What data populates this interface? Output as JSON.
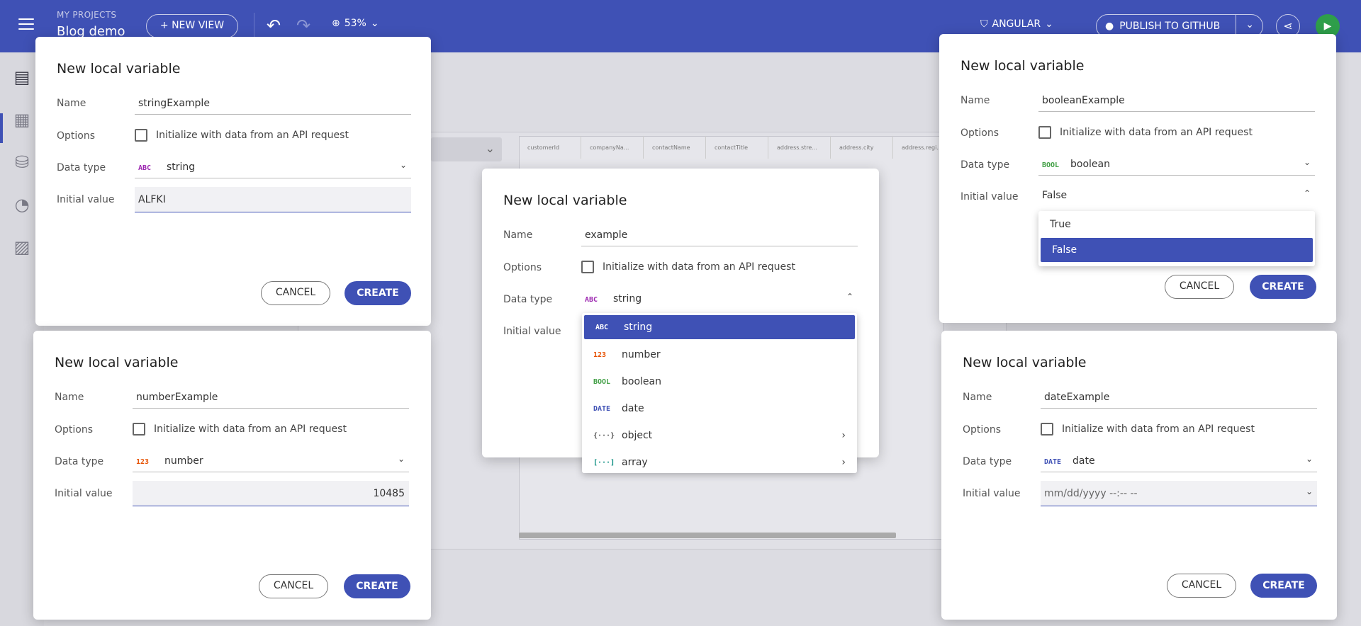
{
  "topbar": {
    "project_label": "MY PROJECTS",
    "project_name": "Blog demo",
    "new_view_label": "+ NEW VIEW",
    "zoom_level": "53%",
    "framework": "ANGULAR",
    "publish_label": "PUBLISH TO GITHUB"
  },
  "background_grid": {
    "columns": [
      "customerId",
      "companyNa...",
      "contactName",
      "contactTitle",
      "address.stre...",
      "address.city",
      "address.regi..."
    ]
  },
  "dialog_common": {
    "title": "New local variable",
    "name_label": "Name",
    "options_label": "Options",
    "checkbox_label": "Initialize with data from an API request",
    "data_type_label": "Data type",
    "initial_value_label": "Initial value",
    "cancel_label": "CANCEL",
    "create_label": "CREATE"
  },
  "dialog_string": {
    "name_value": "stringExample",
    "type_badge": "ABC",
    "type_value": "string",
    "initial_value": "ALFKI"
  },
  "dialog_number": {
    "name_value": "numberExample",
    "type_badge": "123",
    "type_value": "number",
    "initial_value": "10485"
  },
  "dialog_example": {
    "name_value": "example",
    "type_badge": "ABC",
    "type_value": "string",
    "dropdown": [
      {
        "badge": "ABC",
        "label": "string",
        "selected": true
      },
      {
        "badge": "123",
        "label": "number"
      },
      {
        "badge": "BOOL",
        "label": "boolean"
      },
      {
        "badge": "DATE",
        "label": "date"
      },
      {
        "badge": "{···}",
        "label": "object",
        "submenu": true
      },
      {
        "badge": "[···]",
        "label": "array",
        "submenu": true
      }
    ]
  },
  "dialog_boolean": {
    "name_value": "booleanExample",
    "type_badge": "BOOL",
    "type_value": "boolean",
    "initial_value": "False",
    "options": [
      "True",
      "False"
    ],
    "selected_option": "False"
  },
  "dialog_date": {
    "name_value": "dateExample",
    "type_badge": "DATE",
    "type_value": "date",
    "initial_value_placeholder": "mm/dd/yyyy --:-- --"
  },
  "colors": {
    "primary": "#3f51b5",
    "string_badge": "#9c27b0",
    "number_badge": "#e65100",
    "boolean_badge": "#43a047",
    "date_badge": "#3f51b5",
    "array_badge": "#00897b"
  }
}
